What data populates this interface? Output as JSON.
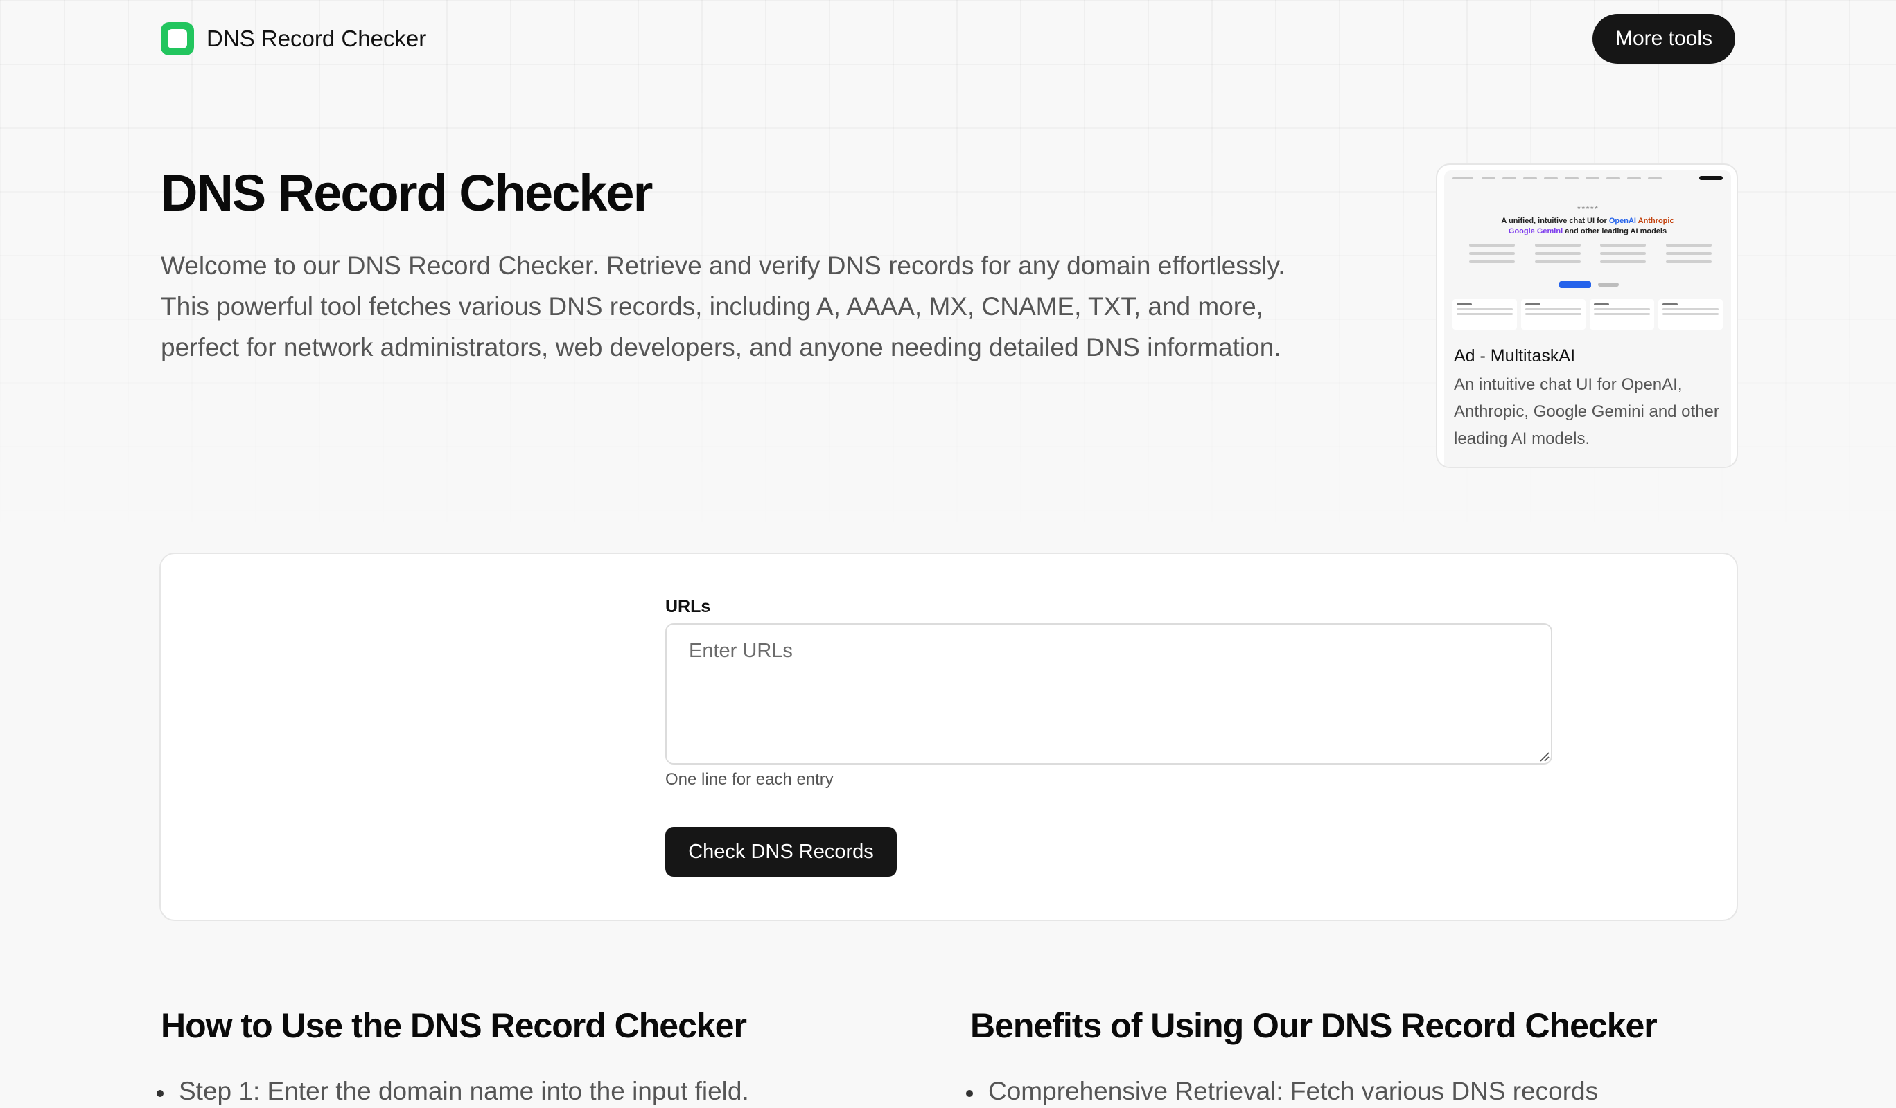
{
  "header": {
    "brand_name": "DNS Record Checker",
    "more_tools_label": "More tools"
  },
  "hero": {
    "title": "DNS Record Checker",
    "description": "Welcome to our DNS Record Checker. Retrieve and verify DNS records for any domain effortlessly. This powerful tool fetches various DNS records, including A, AAAA, MX, CNAME, TXT, and more, perfect for network administrators, web developers, and anyone needing detailed DNS information."
  },
  "ad": {
    "title": "Ad - MultitaskAI",
    "text": "An intuitive chat UI for OpenAI, Anthropic, Google Gemini and other leading AI models.",
    "preview": {
      "headline_prefix": "A unified, intuitive chat UI for",
      "headline_openai": "OpenAI",
      "headline_anthropic": "Anthropic",
      "headline_gemini": "Google Gemini",
      "headline_suffix": "and other leading AI models"
    }
  },
  "tool": {
    "field_label": "URLs",
    "placeholder": "Enter URLs",
    "value": "",
    "hint": "One line for each entry",
    "submit_label": "Check DNS Records"
  },
  "sections": {
    "how_to": {
      "title": "How to Use the DNS Record Checker",
      "items": [
        "Step 1: Enter the domain name into the input field."
      ]
    },
    "benefits": {
      "title": "Benefits of Using Our DNS Record Checker",
      "items": [
        "Comprehensive Retrieval: Fetch various DNS records"
      ]
    }
  },
  "colors": {
    "accent_logo": "#22c55e",
    "button_dark": "#161616",
    "background": "#f8f8f8"
  }
}
